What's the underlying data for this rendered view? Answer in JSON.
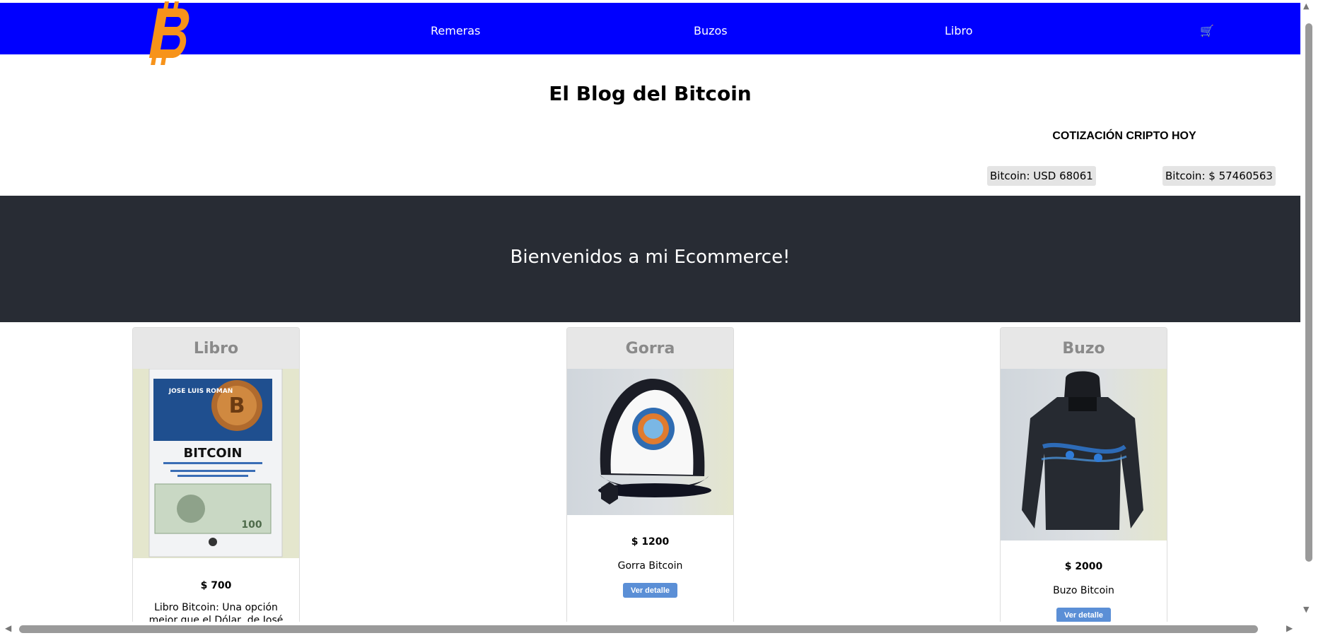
{
  "nav": {
    "links": [
      "Remeras",
      "Buzos",
      "Libro"
    ],
    "cart_icon": "🛒",
    "brand_color": "#0000ff",
    "logo_color": "#f7931a"
  },
  "header": {
    "blog_title": "El Blog del Bitcoin",
    "cotizacion_title": "COTIZACIÓN CRIPTO HOY",
    "price_usd": "Bitcoin: USD 68061",
    "price_ars": "Bitcoin: $ 57460563"
  },
  "hero": {
    "text": "Bienvenidos a mi Ecommerce!",
    "background": "#282c34"
  },
  "products": [
    {
      "title": "Libro",
      "price": "$ 700",
      "description": "Libro Bitcoin: Una opción mejor que el Dólar, de José Román",
      "image_icon": "book-cover-image",
      "cover_author": "JOSE LUIS ROMAN",
      "cover_title": "BITCOIN"
    },
    {
      "title": "Gorra",
      "price": "$ 1200",
      "description": "Gorra Bitcoin",
      "button": "Ver detalle",
      "image_icon": "cap-image"
    },
    {
      "title": "Buzo",
      "price": "$ 2000",
      "description": "Buzo Bitcoin",
      "button": "Ver detalle",
      "image_icon": "hoodie-image"
    }
  ]
}
